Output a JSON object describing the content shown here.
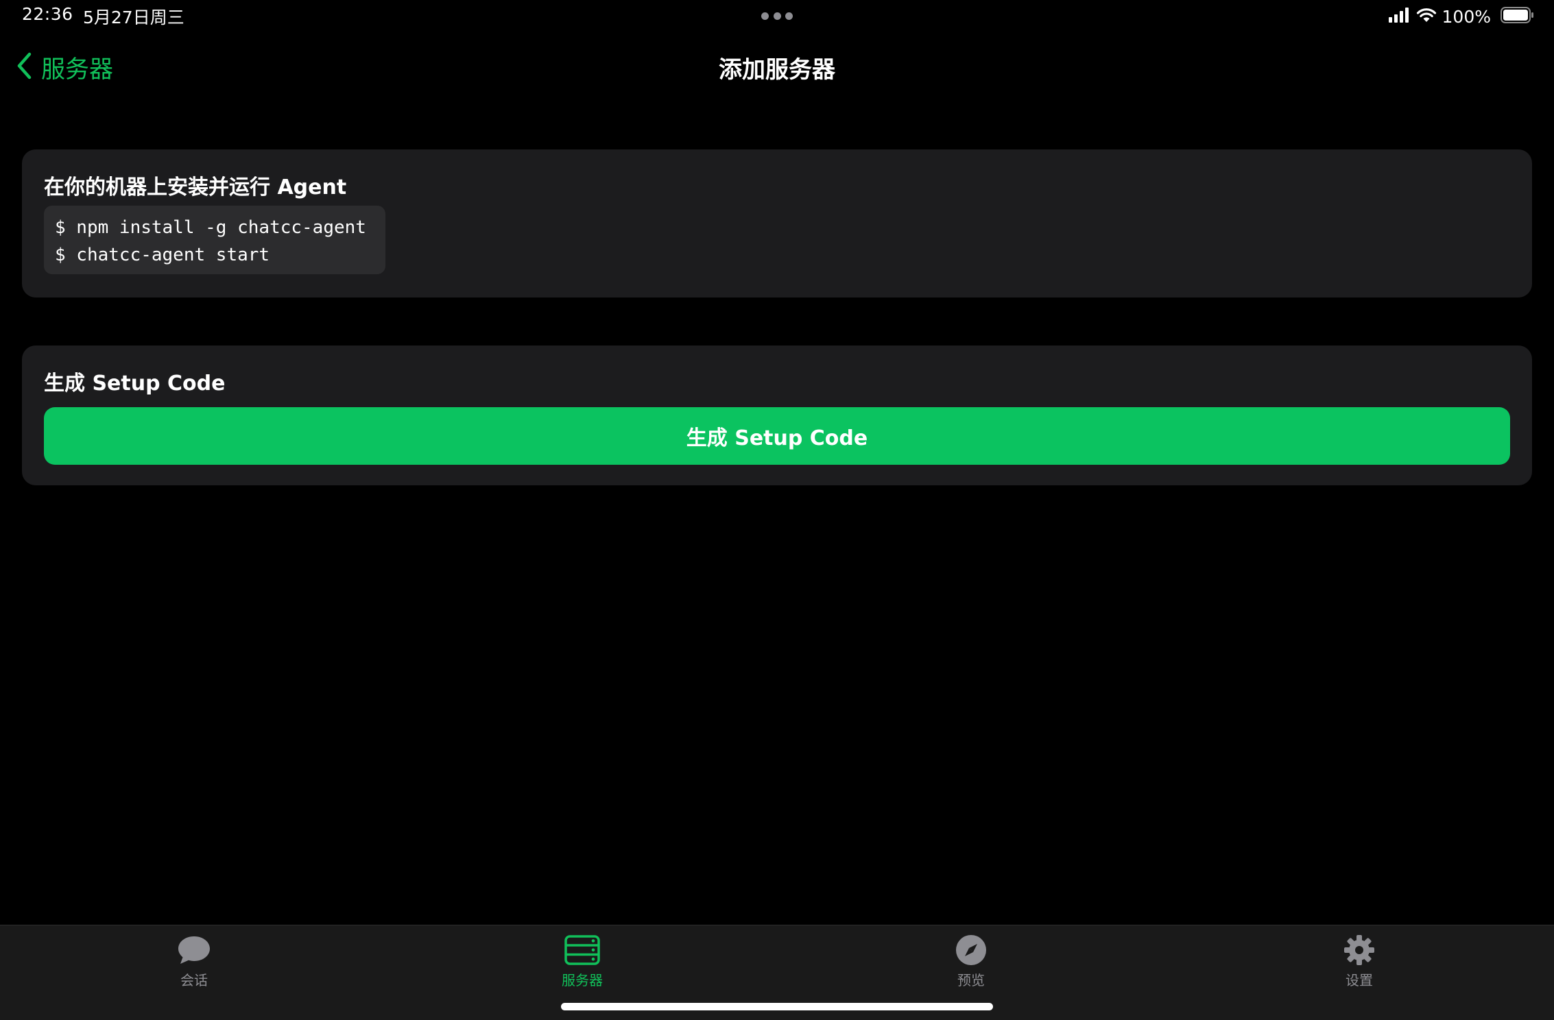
{
  "status_bar": {
    "time": "22:36",
    "date": "5月27日周三",
    "battery_percent": "100%",
    "icons": [
      "signal-icon",
      "wifi-icon",
      "battery-icon"
    ]
  },
  "nav": {
    "back_label": "服务器",
    "title": "添加服务器"
  },
  "install_card": {
    "heading": "在你的机器上安装并运行 Agent",
    "code_lines": [
      "$ npm install -g chatcc-agent",
      "$ chatcc-agent start"
    ]
  },
  "setup_card": {
    "heading": "生成 Setup Code",
    "button_label": "生成 Setup Code"
  },
  "tabs": [
    {
      "label": "会话",
      "icon": "chat-bubble-icon",
      "active": false
    },
    {
      "label": "服务器",
      "icon": "server-icon",
      "active": true
    },
    {
      "label": "预览",
      "icon": "compass-icon",
      "active": false
    },
    {
      "label": "设置",
      "icon": "gear-icon",
      "active": false
    }
  ],
  "colors": {
    "accent": "#11c05a",
    "button": "#0bc360",
    "card_bg": "#1c1c1e",
    "code_bg": "#2c2c2e",
    "tab_inactive": "#8e8e93"
  }
}
